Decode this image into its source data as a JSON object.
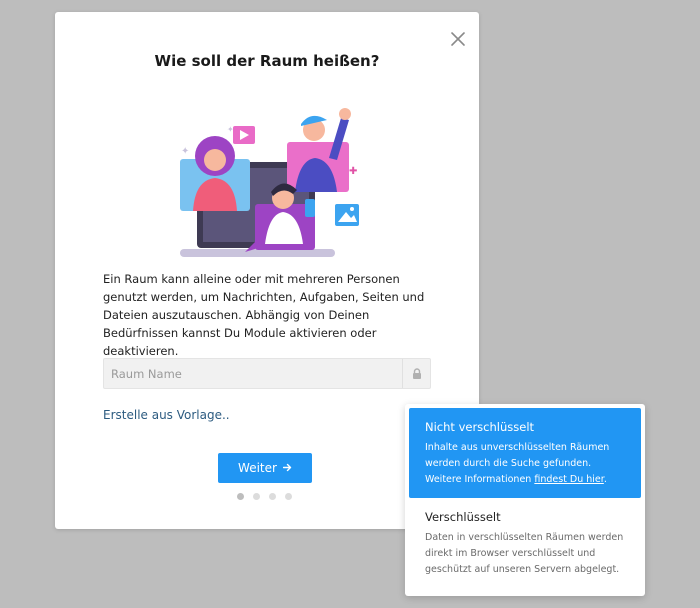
{
  "dialog": {
    "title": "Wie soll der Raum heißen?",
    "description": "Ein Raum kann alleine oder mit mehreren Personen genutzt werden, um Nachrichten, Aufgaben, Seiten und Dateien auszutauschen. Abhängig von Deinen Bedürfnissen kannst Du Module aktivieren oder deaktivieren.",
    "name_input": {
      "value": "",
      "placeholder": "Raum Name"
    },
    "template_link": "Erstelle aus Vorlage..",
    "next_button": "Weiter",
    "steps": {
      "current": 1,
      "total": 4
    }
  },
  "encryption_menu": {
    "options": [
      {
        "title": "Nicht verschlüsselt",
        "description_before_link": "Inhalte aus unverschlüsselten Räumen werden durch die Suche gefunden. Weitere Informationen ",
        "link_text": "findest Du hier",
        "description_after_link": ".",
        "selected": true
      },
      {
        "title": "Verschlüsselt",
        "description": "Daten in verschlüsselten Räumen werden direkt im Browser verschlüsselt und geschützt auf unseren Servern abgelegt.",
        "selected": false
      }
    ]
  },
  "icons": {
    "close": "close-icon",
    "lock": "lock-icon",
    "arrow": "arrow-right-icon"
  },
  "colors": {
    "accent": "#2196f3",
    "link": "#2c5b80",
    "backdrop": "#bdbdbd"
  }
}
